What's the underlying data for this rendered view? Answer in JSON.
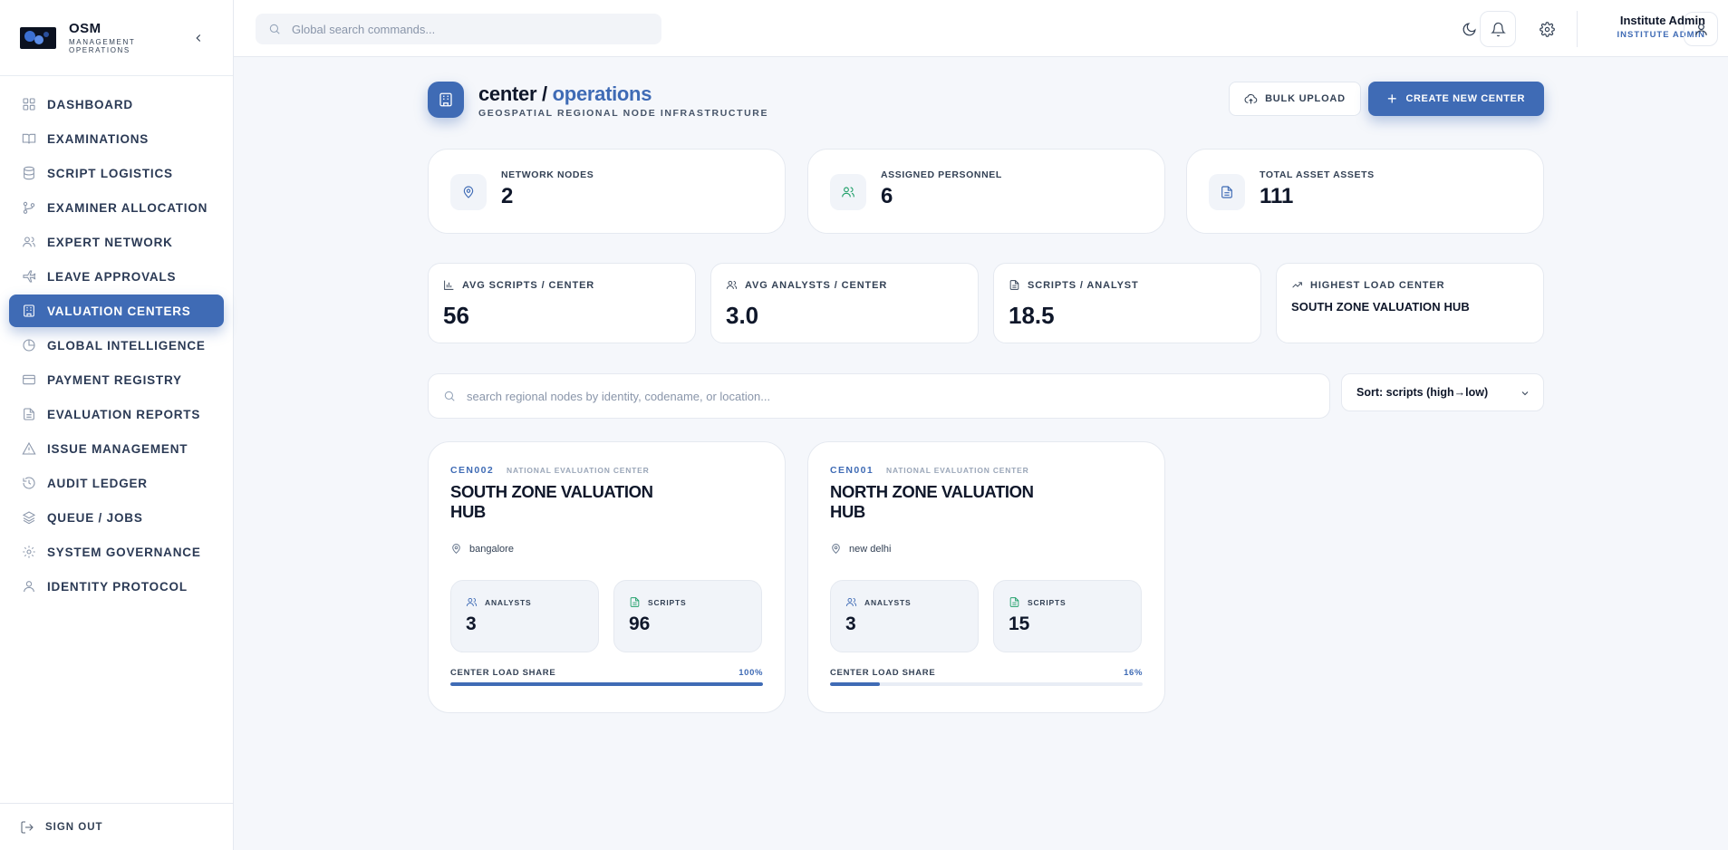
{
  "brand": {
    "title": "OSM",
    "subtitle": "MANAGEMENT OPERATIONS"
  },
  "sidebar": {
    "items": [
      {
        "label": "DASHBOARD",
        "icon": "grid-icon",
        "active": false
      },
      {
        "label": "EXAMINATIONS",
        "icon": "book-open-icon",
        "active": false
      },
      {
        "label": "SCRIPT LOGISTICS",
        "icon": "database-icon",
        "active": false
      },
      {
        "label": "EXAMINER ALLOCATION",
        "icon": "git-branch-icon",
        "active": false
      },
      {
        "label": "EXPERT NETWORK",
        "icon": "users-icon",
        "active": false
      },
      {
        "label": "LEAVE APPROVALS",
        "icon": "plane-icon",
        "active": false
      },
      {
        "label": "VALUATION CENTERS",
        "icon": "building-icon",
        "active": true
      },
      {
        "label": "GLOBAL INTELLIGENCE",
        "icon": "pie-chart-icon",
        "active": false
      },
      {
        "label": "PAYMENT REGISTRY",
        "icon": "credit-card-icon",
        "active": false
      },
      {
        "label": "EVALUATION REPORTS",
        "icon": "file-text-icon",
        "active": false
      },
      {
        "label": "ISSUE MANAGEMENT",
        "icon": "alert-triangle-icon",
        "active": false
      },
      {
        "label": "AUDIT LEDGER",
        "icon": "history-icon",
        "active": false
      },
      {
        "label": "QUEUE / JOBS",
        "icon": "layers-icon",
        "active": false
      },
      {
        "label": "SYSTEM GOVERNANCE",
        "icon": "gear-icon",
        "active": false
      },
      {
        "label": "IDENTITY PROTOCOL",
        "icon": "user-icon",
        "active": false
      }
    ],
    "signout_label": "SIGN OUT"
  },
  "header": {
    "search_placeholder": "Global search commands...",
    "user_name": "Institute Admin",
    "user_role": "INSTITUTE ADMIN"
  },
  "page": {
    "title_prefix": "center /",
    "title_accent": "operations",
    "subtitle": "GEOSPATIAL REGIONAL NODE INFRASTRUCTURE",
    "bulk_upload_label": "BULK UPLOAD",
    "create_label": "CREATE NEW CENTER"
  },
  "stats_primary": [
    {
      "label": "NETWORK NODES",
      "value": "2",
      "icon": "map-pin-icon",
      "color": "#3f6bb5"
    },
    {
      "label": "ASSIGNED PERSONNEL",
      "value": "6",
      "icon": "users-icon",
      "color": "#22a06b"
    },
    {
      "label": "TOTAL ASSET ASSETS",
      "value": "111",
      "icon": "file-text-icon",
      "color": "#3f6bb5"
    }
  ],
  "stats_secondary": [
    {
      "label": "AVG SCRIPTS / CENTER",
      "value": "56",
      "icon": "bar-chart-icon"
    },
    {
      "label": "AVG ANALYSTS / CENTER",
      "value": "3.0",
      "icon": "users-icon"
    },
    {
      "label": "SCRIPTS / ANALYST",
      "value": "18.5",
      "icon": "file-text-icon"
    },
    {
      "label": "HIGHEST LOAD CENTER",
      "value": "SOUTH ZONE VALUATION HUB",
      "icon": "trending-up-icon"
    }
  ],
  "filters": {
    "search_placeholder": "search regional nodes by identity, codename, or location...",
    "sort_value": "Sort: scripts (high→low)"
  },
  "centers": [
    {
      "code": "CEN002",
      "type": "NATIONAL EVALUATION CENTER",
      "name": "SOUTH ZONE VALUATION HUB",
      "location": "bangalore",
      "analysts_label": "ANALYSTS",
      "analysts": "3",
      "scripts_label": "SCRIPTS",
      "scripts": "96",
      "share_label": "CENTER LOAD SHARE",
      "share_pct": "100%",
      "share_value": 100
    },
    {
      "code": "CEN001",
      "type": "NATIONAL EVALUATION CENTER",
      "name": "NORTH ZONE VALUATION HUB",
      "location": "new delhi",
      "analysts_label": "ANALYSTS",
      "analysts": "3",
      "scripts_label": "SCRIPTS",
      "scripts": "15",
      "share_label": "CENTER LOAD SHARE",
      "share_pct": "16%",
      "share_value": 16
    }
  ],
  "colors": {
    "accent": "#3f6bb5",
    "success": "#22a06b",
    "background": "#f5f7fb"
  }
}
